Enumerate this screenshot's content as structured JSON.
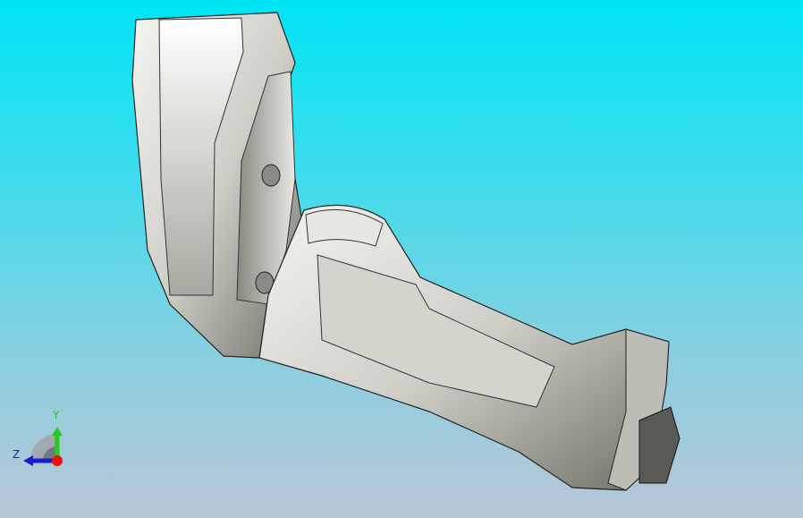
{
  "viewport": {
    "background_top": "#00e4f4",
    "background_bottom": "#b7c6d6",
    "model_color": "#d8d8d2"
  },
  "triad": {
    "x_label": "",
    "y_label": "Y",
    "z_label": "Z",
    "y_color": "#22cc22",
    "z_color": "#1a1ad0",
    "x_color": "#ee1111"
  }
}
